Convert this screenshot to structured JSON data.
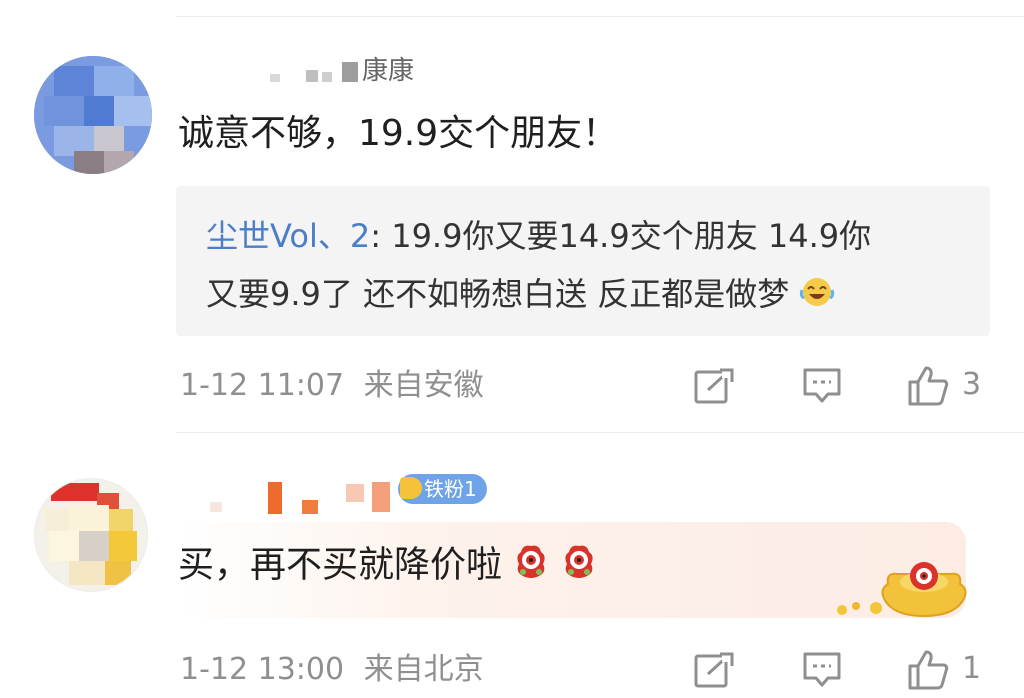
{
  "comments": [
    {
      "username_visible": "康康",
      "text": "诚意不够，19.9交个朋友！",
      "reply": {
        "author": "尘世Vol、2",
        "line1_text": ": 19.9你又要14.9交个朋友 14.9你",
        "line2_text": "又要9.9了 还不如畅想白送 反正都是做梦",
        "emoji": "laughing-tears-icon"
      },
      "time": "1-12 11:07",
      "location": "来自安徽",
      "like_count": "3"
    },
    {
      "badge": "铁粉1",
      "text": "买，再不买就降价啦",
      "emoji": "red-creature-icon",
      "decoration": "gold-ingot-icon",
      "time": "1-12 13:00",
      "location": "来自北京",
      "like_count": "1"
    }
  ],
  "colors": {
    "reply_author": "#4a7fc8",
    "meta_gray": "#8f8f8f",
    "badge_blue": "#6ea3e8"
  },
  "icons": [
    "share-icon",
    "comment-icon",
    "like-icon"
  ]
}
